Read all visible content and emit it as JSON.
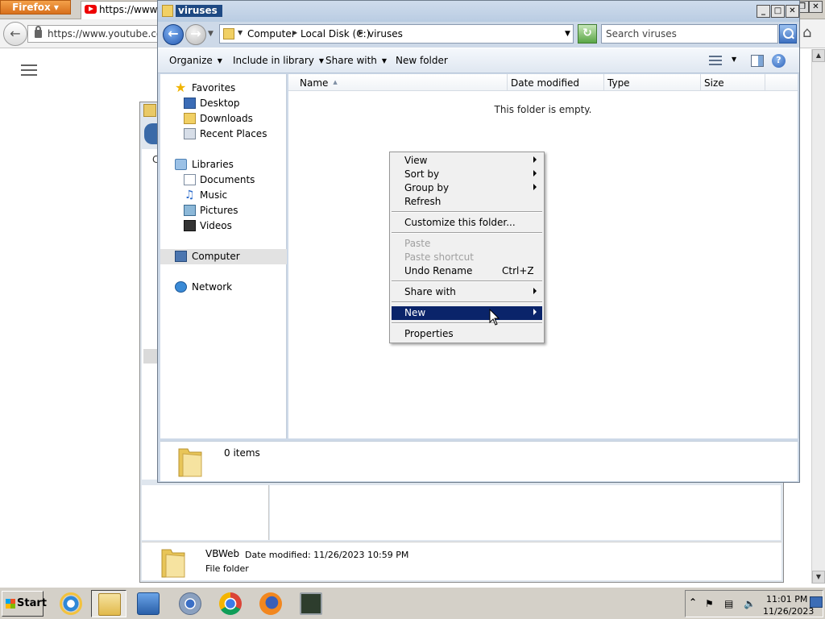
{
  "firefox": {
    "menu_label": "Firefox",
    "tab_title": "https://www.y",
    "url": "https://www.youtube.com/r",
    "win_buttons": [
      "❐",
      "✕"
    ]
  },
  "bg_window": {
    "partial_label": "C",
    "item": {
      "name": "VBWeb",
      "date_label": "Date modified:  11/26/2023 10:59 PM",
      "type": "File folder"
    }
  },
  "window": {
    "title": "viruses",
    "controls": [
      "_",
      "□",
      "✕"
    ]
  },
  "address": {
    "crumbs": [
      "Computer",
      "Local Disk (C:)",
      "viruses"
    ],
    "search_placeholder": "Search viruses"
  },
  "toolbar": {
    "organize": "Organize",
    "include_in_library": "Include in library",
    "share_with": "Share with",
    "new_folder": "New folder"
  },
  "nav": {
    "favorites": "Favorites",
    "desktop": "Desktop",
    "downloads": "Downloads",
    "recent_places": "Recent Places",
    "libraries": "Libraries",
    "documents": "Documents",
    "music": "Music",
    "pictures": "Pictures",
    "videos": "Videos",
    "computer": "Computer",
    "network": "Network"
  },
  "columns": {
    "name": "Name",
    "date_modified": "Date modified",
    "type": "Type",
    "size": "Size"
  },
  "content": {
    "empty_message": "This folder is empty."
  },
  "details": {
    "item_count": "0 items"
  },
  "context_menu": {
    "view": "View",
    "sort_by": "Sort by",
    "group_by": "Group by",
    "refresh": "Refresh",
    "customize": "Customize this folder...",
    "paste": "Paste",
    "paste_shortcut": "Paste shortcut",
    "undo_rename": "Undo Rename",
    "undo_shortcut": "Ctrl+Z",
    "share_with": "Share with",
    "new": "New",
    "properties": "Properties"
  },
  "taskbar": {
    "start": "Start",
    "time": "11:01 PM",
    "date": "11/26/2023"
  }
}
